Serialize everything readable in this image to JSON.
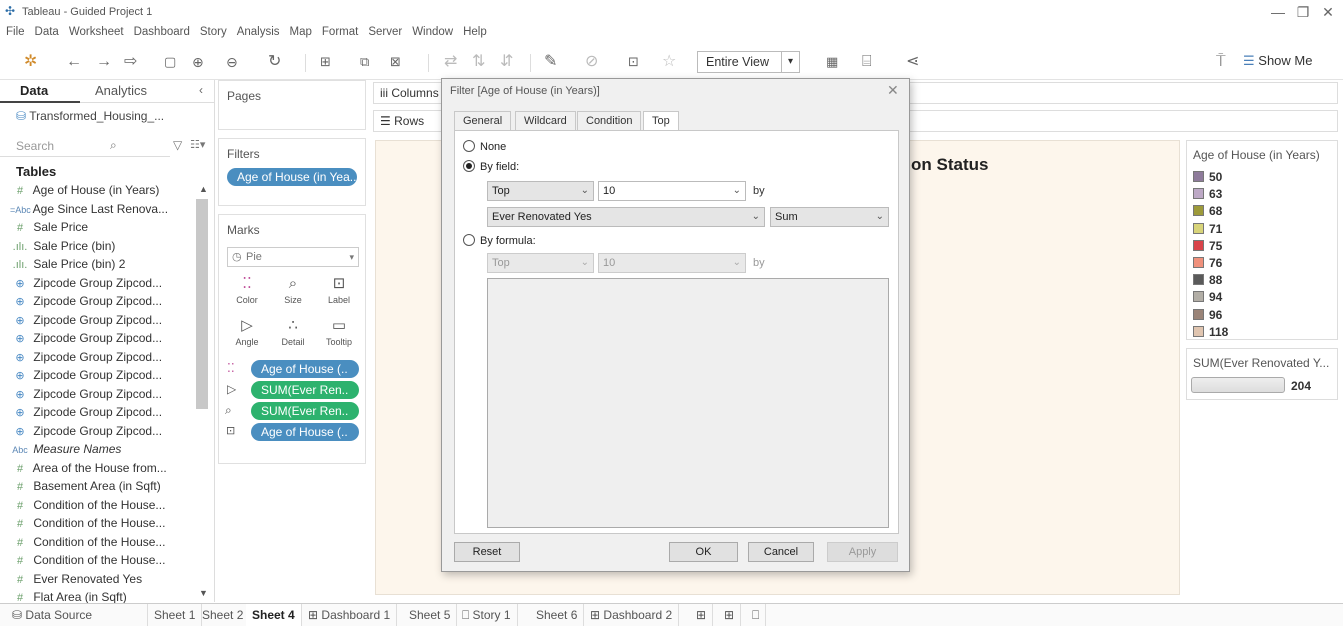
{
  "window": {
    "title": "Tableau - Guided Project 1"
  },
  "menu": [
    "File",
    "Data",
    "Worksheet",
    "Dashboard",
    "Story",
    "Analysis",
    "Map",
    "Format",
    "Server",
    "Window",
    "Help"
  ],
  "toolbar": {
    "fit": "Entire View",
    "show_me": "Show Me"
  },
  "datapane": {
    "tab_data": "Data",
    "tab_analytics": "Analytics",
    "datasource": "Transformed_Housing_...",
    "search_placeholder": "Search",
    "tables_header": "Tables",
    "fields": [
      {
        "icon": "#",
        "name": "Age of House (in Years)"
      },
      {
        "icon": "=Abc",
        "name": "Age Since Last Renova..."
      },
      {
        "icon": "#",
        "name": "Sale Price"
      },
      {
        "icon": ".ılı.",
        "name": "Sale Price (bin)"
      },
      {
        "icon": ".ılı.",
        "name": "Sale Price (bin) 2"
      },
      {
        "icon": "⊕",
        "name": "Zipcode Group Zipcod..."
      },
      {
        "icon": "⊕",
        "name": "Zipcode Group Zipcod..."
      },
      {
        "icon": "⊕",
        "name": "Zipcode Group Zipcod..."
      },
      {
        "icon": "⊕",
        "name": "Zipcode Group Zipcod..."
      },
      {
        "icon": "⊕",
        "name": "Zipcode Group Zipcod..."
      },
      {
        "icon": "⊕",
        "name": "Zipcode Group Zipcod..."
      },
      {
        "icon": "⊕",
        "name": "Zipcode Group Zipcod..."
      },
      {
        "icon": "⊕",
        "name": "Zipcode Group Zipcod..."
      },
      {
        "icon": "⊕",
        "name": "Zipcode Group Zipcod..."
      },
      {
        "icon": "Abc",
        "name": "Measure Names"
      },
      {
        "icon": "#",
        "name": "Area of the House from..."
      },
      {
        "icon": "#",
        "name": "Basement Area (in Sqft)"
      },
      {
        "icon": "#",
        "name": "Condition of the House..."
      },
      {
        "icon": "#",
        "name": "Condition of the House..."
      },
      {
        "icon": "#",
        "name": "Condition of the House..."
      },
      {
        "icon": "#",
        "name": "Condition of the House..."
      },
      {
        "icon": "#",
        "name": "Ever Renovated Yes"
      },
      {
        "icon": "#",
        "name": "Flat Area (in Sqft)"
      }
    ]
  },
  "shelves": {
    "pages": "Pages",
    "filters": "Filters",
    "filter_pill": "Age of House (in Yea..",
    "marks": "Marks",
    "mark_type": "Pie",
    "mark_buttons": [
      "Color",
      "Size",
      "Label",
      "Angle",
      "Detail",
      "Tooltip"
    ],
    "mark_pills": [
      {
        "label": "Age of House (..",
        "color": "blue"
      },
      {
        "label": "SUM(Ever Ren..",
        "color": "green"
      },
      {
        "label": "SUM(Ever Ren..",
        "color": "green"
      },
      {
        "label": "Age of House (..",
        "color": "blue"
      }
    ],
    "columns": "Columns",
    "rows": "Rows"
  },
  "canvas": {
    "title_fragment": "on Status"
  },
  "legend": {
    "header": "Age of House (in Years)",
    "items": [
      {
        "label": "50",
        "color": "#8e7b9b"
      },
      {
        "label": "63",
        "color": "#bda9c6"
      },
      {
        "label": "68",
        "color": "#9d9a3a"
      },
      {
        "label": "71",
        "color": "#d8d47a"
      },
      {
        "label": "75",
        "color": "#d9434a"
      },
      {
        "label": "76",
        "color": "#f0917c"
      },
      {
        "label": "88",
        "color": "#5a5a5a"
      },
      {
        "label": "94",
        "color": "#b2aea6"
      },
      {
        "label": "96",
        "color": "#9a8478"
      },
      {
        "label": "118",
        "color": "#e0c5b0"
      }
    ],
    "size_header": "SUM(Ever Renovated Y...",
    "size_value": "204"
  },
  "bottom_tabs": [
    "Data Source",
    "Sheet 1",
    "Sheet 2",
    "Sheet 4",
    "Dashboard 1",
    "Sheet 5",
    "Story 1",
    "Sheet 6",
    "Dashboard 2"
  ],
  "dialog": {
    "title": "Filter [Age of House (in Years)]",
    "tabs": [
      "General",
      "Wildcard",
      "Condition",
      "Top"
    ],
    "none_label": "None",
    "by_field_label": "By field:",
    "top_value": "Top",
    "n_value": "10",
    "by_label": "by",
    "field_value": "Ever Renovated Yes",
    "agg_value": "Sum",
    "by_formula_label": "By formula:",
    "formula_top": "Top",
    "formula_n": "10",
    "buttons": {
      "reset": "Reset",
      "ok": "OK",
      "cancel": "Cancel",
      "apply": "Apply"
    }
  }
}
